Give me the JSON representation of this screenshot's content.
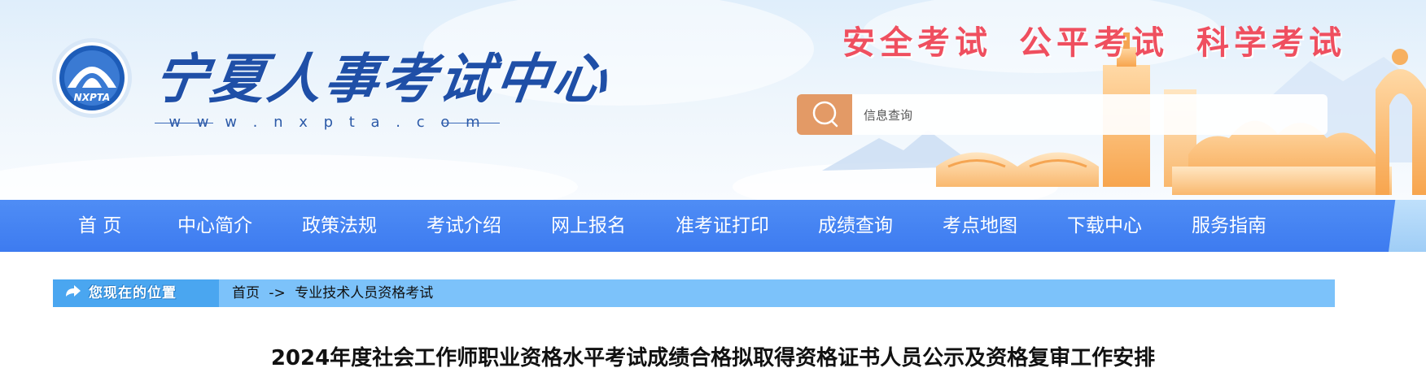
{
  "header": {
    "site_title": "宁夏人事考试中心",
    "site_url": "w w w . n x p t a . c o m",
    "logo_text": "NXPTA",
    "slogans": [
      "安全考试",
      "公平考试",
      "科学考试"
    ],
    "search": {
      "placeholder": "信息查询"
    }
  },
  "nav": {
    "items": [
      {
        "label": "首 页"
      },
      {
        "label": "中心简介"
      },
      {
        "label": "政策法规"
      },
      {
        "label": "考试介绍"
      },
      {
        "label": "网上报名"
      },
      {
        "label": "准考证打印"
      },
      {
        "label": "成绩查询"
      },
      {
        "label": "考点地图"
      },
      {
        "label": "下载中心"
      },
      {
        "label": "服务指南"
      }
    ]
  },
  "breadcrumb": {
    "label": "您现在的位置",
    "items": [
      "首页",
      "->",
      "专业技术人员资格考试"
    ]
  },
  "article": {
    "title": "2024年度社会工作师职业资格水平考试成绩合格拟取得资格证书人员公示及资格复审工作安排"
  },
  "colors": {
    "nav_bg": "#3d7bf0",
    "breadcrumb_bg": "#7cc2fa",
    "slogan": "#ef4f5f",
    "title_blue": "#1f4fa7",
    "search_button": "#e39a66"
  }
}
